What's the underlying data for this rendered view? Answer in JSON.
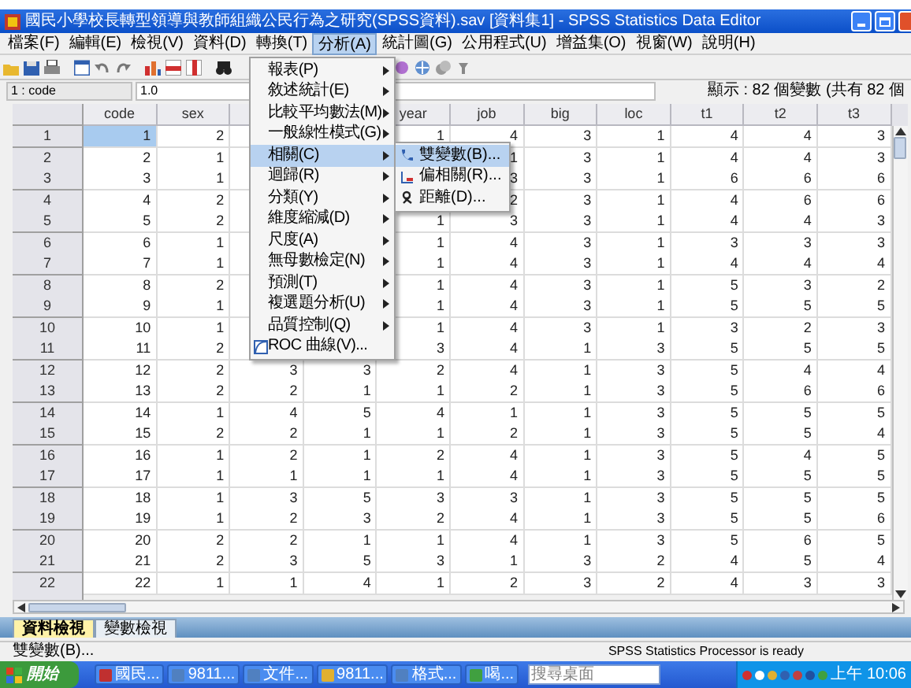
{
  "window": {
    "title": "國民小學校長轉型領導與教師組織公民行為之研究(SPSS資料).sav [資料集1] - SPSS Statistics Data Editor"
  },
  "menu_bar": [
    {
      "label": "檔案(F)",
      "selected": false
    },
    {
      "label": "編輯(E)",
      "selected": false
    },
    {
      "label": "檢視(V)",
      "selected": false
    },
    {
      "label": "資料(D)",
      "selected": false
    },
    {
      "label": "轉換(T)",
      "selected": false
    },
    {
      "label": "分析(A)",
      "selected": true
    },
    {
      "label": "統計圖(G)",
      "selected": false
    },
    {
      "label": "公用程式(U)",
      "selected": false
    },
    {
      "label": "增益集(O)",
      "selected": false
    },
    {
      "label": "視窗(W)",
      "selected": false
    },
    {
      "label": "說明(H)",
      "selected": false
    }
  ],
  "cell_editor": {
    "cell": "1 : code",
    "value": "1.0",
    "info": "顯示 : 82 個變數 (共有 82 個"
  },
  "analyze_menu": [
    {
      "label": "報表(P)",
      "kind": "submenu",
      "selected": false
    },
    {
      "label": "敘述統計(E)",
      "kind": "submenu",
      "selected": false
    },
    {
      "label": "比較平均數法(M)",
      "kind": "submenu",
      "selected": false
    },
    {
      "label": "一般線性模式(G)",
      "kind": "submenu",
      "selected": false
    },
    {
      "label": "相關(C)",
      "kind": "submenu",
      "selected": true
    },
    {
      "label": "迴歸(R)",
      "kind": "submenu",
      "selected": false
    },
    {
      "label": "分類(Y)",
      "kind": "submenu",
      "selected": false
    },
    {
      "label": "維度縮減(D)",
      "kind": "submenu",
      "selected": false
    },
    {
      "label": "尺度(A)",
      "kind": "submenu",
      "selected": false
    },
    {
      "label": "無母數檢定(N)",
      "kind": "submenu",
      "selected": false
    },
    {
      "label": "預測(T)",
      "kind": "submenu",
      "selected": false
    },
    {
      "label": "複選題分析(U)",
      "kind": "submenu",
      "selected": false
    },
    {
      "label": "品質控制(Q)",
      "kind": "submenu",
      "selected": false
    },
    {
      "label": "ROC 曲線(V)...",
      "kind": "dialog",
      "selected": false
    }
  ],
  "correlate_submenu": [
    {
      "label": "雙變數(B)...",
      "selected": true
    },
    {
      "label": "偏相關(R)...",
      "selected": false
    },
    {
      "label": "距離(D)...",
      "selected": false
    }
  ],
  "data_grid": {
    "columns": [
      "code",
      "sex",
      null,
      null,
      "year",
      "job",
      "big",
      "loc",
      "t1",
      "t2",
      "t3"
    ],
    "rows": [
      {
        "number": "1",
        "selected": true,
        "cells": [
          "1",
          "2",
          null,
          null,
          "1",
          "4",
          "3",
          "1",
          "4",
          "4",
          "3"
        ]
      },
      {
        "number": "2",
        "selected": false,
        "cells": [
          "2",
          "1",
          null,
          null,
          null,
          "1",
          "3",
          "1",
          "4",
          "4",
          "3"
        ]
      },
      {
        "number": "3",
        "selected": false,
        "cells": [
          "3",
          "1",
          null,
          null,
          null,
          "3",
          "3",
          "1",
          "6",
          "6",
          "6"
        ]
      },
      {
        "number": "4",
        "selected": false,
        "cells": [
          "4",
          "2",
          null,
          null,
          null,
          "2",
          "3",
          "1",
          "4",
          "6",
          "6"
        ]
      },
      {
        "number": "5",
        "selected": false,
        "cells": [
          "5",
          "2",
          null,
          null,
          "1",
          "3",
          "3",
          "1",
          "4",
          "4",
          "3"
        ]
      },
      {
        "number": "6",
        "selected": false,
        "cells": [
          "6",
          "1",
          null,
          null,
          "1",
          "4",
          "3",
          "1",
          "3",
          "3",
          "3"
        ]
      },
      {
        "number": "7",
        "selected": false,
        "cells": [
          "7",
          "1",
          null,
          null,
          "1",
          "4",
          "3",
          "1",
          "4",
          "4",
          "4"
        ]
      },
      {
        "number": "8",
        "selected": false,
        "cells": [
          "8",
          "2",
          null,
          null,
          "1",
          "4",
          "3",
          "1",
          "5",
          "3",
          "2"
        ]
      },
      {
        "number": "9",
        "selected": false,
        "cells": [
          "9",
          "1",
          null,
          null,
          "1",
          "4",
          "3",
          "1",
          "5",
          "5",
          "5"
        ]
      },
      {
        "number": "10",
        "selected": false,
        "cells": [
          "10",
          "1",
          null,
          null,
          "1",
          "4",
          "3",
          "1",
          "3",
          "2",
          "3"
        ]
      },
      {
        "number": "11",
        "selected": false,
        "cells": [
          "11",
          "2",
          null,
          null,
          "3",
          "4",
          "1",
          "3",
          "5",
          "5",
          "5"
        ]
      },
      {
        "number": "12",
        "selected": false,
        "cells": [
          "12",
          "2",
          "3",
          "3",
          "2",
          "4",
          "1",
          "3",
          "5",
          "4",
          "4"
        ]
      },
      {
        "number": "13",
        "selected": false,
        "cells": [
          "13",
          "2",
          "2",
          "1",
          "1",
          "2",
          "1",
          "3",
          "5",
          "6",
          "6"
        ]
      },
      {
        "number": "14",
        "selected": false,
        "cells": [
          "14",
          "1",
          "4",
          "5",
          "4",
          "1",
          "1",
          "3",
          "5",
          "5",
          "5"
        ]
      },
      {
        "number": "15",
        "selected": false,
        "cells": [
          "15",
          "2",
          "2",
          "1",
          "1",
          "2",
          "1",
          "3",
          "5",
          "5",
          "4"
        ]
      },
      {
        "number": "16",
        "selected": false,
        "cells": [
          "16",
          "1",
          "2",
          "1",
          "2",
          "4",
          "1",
          "3",
          "5",
          "4",
          "5"
        ]
      },
      {
        "number": "17",
        "selected": false,
        "cells": [
          "17",
          "1",
          "1",
          "1",
          "1",
          "4",
          "1",
          "3",
          "5",
          "5",
          "5"
        ]
      },
      {
        "number": "18",
        "selected": false,
        "cells": [
          "18",
          "1",
          "3",
          "5",
          "3",
          "3",
          "1",
          "3",
          "5",
          "5",
          "5"
        ]
      },
      {
        "number": "19",
        "selected": false,
        "cells": [
          "19",
          "1",
          "2",
          "3",
          "2",
          "4",
          "1",
          "3",
          "5",
          "5",
          "6"
        ]
      },
      {
        "number": "20",
        "selected": false,
        "cells": [
          "20",
          "2",
          "2",
          "1",
          "1",
          "4",
          "1",
          "3",
          "5",
          "6",
          "5"
        ]
      },
      {
        "number": "21",
        "selected": false,
        "cells": [
          "21",
          "2",
          "3",
          "5",
          "3",
          "1",
          "3",
          "2",
          "4",
          "5",
          "4"
        ]
      },
      {
        "number": "22",
        "selected": false,
        "cells": [
          "22",
          "1",
          "1",
          "4",
          "1",
          "2",
          "3",
          "2",
          "4",
          "3",
          "3"
        ]
      }
    ]
  },
  "view_tabs": [
    {
      "label": "資料檢視",
      "selected": true
    },
    {
      "label": "變數檢視",
      "selected": false
    }
  ],
  "status_bar": {
    "message": "雙變數(B)...",
    "processor": "SPSS Statistics  Processor is ready"
  },
  "taskbar": {
    "start": "開始",
    "tasks": [
      "國民...",
      "9811...",
      "文件...",
      "9811...",
      "格式...",
      "喝..."
    ],
    "search": {
      "placeholder": "搜尋桌面"
    },
    "clock": "上午 10:06"
  }
}
